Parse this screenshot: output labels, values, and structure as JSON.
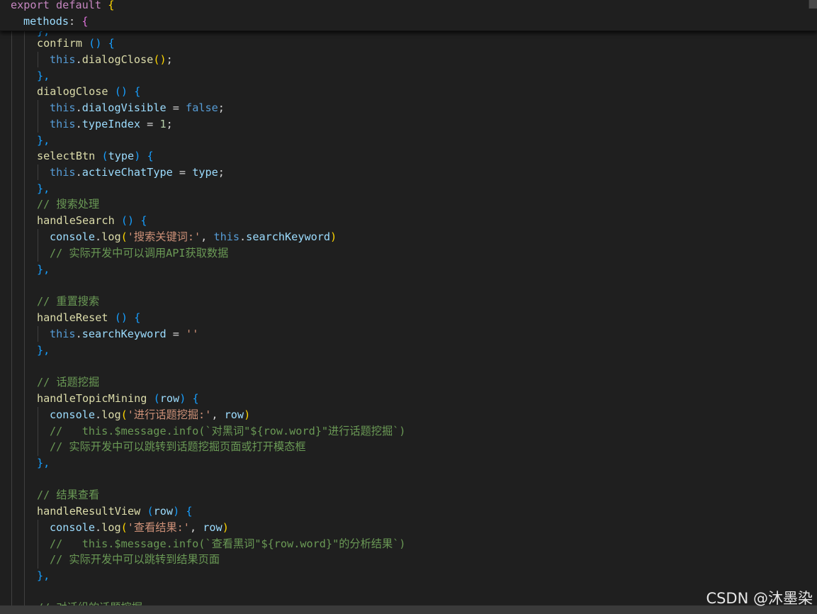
{
  "sticky": {
    "line1": {
      "kw1": "export",
      "kw2": "default",
      "brace": "{"
    },
    "line2": {
      "name": "methods",
      "colon": ":",
      "brace": "{"
    },
    "peek": "},"
  },
  "code": {
    "confirm": {
      "name": "confirm",
      "parens": "()",
      "brace": "{"
    },
    "confirm_body": {
      "this": "this",
      "dot": ".",
      "call": "dialogClose",
      "args": "()",
      "semi": ";"
    },
    "close1": "},",
    "dialogClose": {
      "name": "dialogClose",
      "parens": "()",
      "brace": "{"
    },
    "dc_line1": {
      "this": "this",
      "dot": ".",
      "prop": "dialogVisible",
      "eq": " = ",
      "val": "false",
      "semi": ";"
    },
    "dc_line2": {
      "this": "this",
      "dot": ".",
      "prop": "typeIndex",
      "eq": " = ",
      "val": "1",
      "semi": ";"
    },
    "close2": "},",
    "selectBtn": {
      "name": "selectBtn",
      "open": "(",
      "param": "type",
      "close": ")",
      "brace": "{"
    },
    "sb_line1": {
      "this": "this",
      "dot": ".",
      "prop": "activeChatType",
      "eq": " = ",
      "val": "type",
      "semi": ";"
    },
    "close3": "},",
    "comment_search": "// 搜索处理",
    "handleSearch": {
      "name": "handleSearch",
      "parens": "()",
      "brace": "{"
    },
    "hs_line1": {
      "obj": "console",
      "dot": ".",
      "fn": "log",
      "open": "(",
      "str": "'搜索关键词:'",
      "comma": ", ",
      "this": "this",
      "dot2": ".",
      "prop": "searchKeyword",
      "close": ")"
    },
    "hs_comment": "// 实际开发中可以调用API获取数据",
    "close4": "},",
    "comment_reset": "// 重置搜索",
    "handleReset": {
      "name": "handleReset",
      "parens": "()",
      "brace": "{"
    },
    "hr_line1": {
      "this": "this",
      "dot": ".",
      "prop": "searchKeyword",
      "eq": " = ",
      "val": "''"
    },
    "close5": "},",
    "comment_topic": "// 话题挖掘",
    "handleTopicMining": {
      "name": "handleTopicMining",
      "open": "(",
      "param": "row",
      "close": ")",
      "brace": "{"
    },
    "ht_line1": {
      "obj": "console",
      "dot": ".",
      "fn": "log",
      "open": "(",
      "str": "'进行话题挖掘:'",
      "comma": ", ",
      "arg": "row",
      "close": ")"
    },
    "ht_comment1": "//   this.$message.info(`对黑词\"${row.word}\"进行话题挖掘`)",
    "ht_comment2": "// 实际开发中可以跳转到话题挖掘页面或打开模态框",
    "close6": "},",
    "comment_result": "// 结果查看",
    "handleResultView": {
      "name": "handleResultView",
      "open": "(",
      "param": "row",
      "close": ")",
      "brace": "{"
    },
    "hv_line1": {
      "obj": "console",
      "dot": ".",
      "fn": "log",
      "open": "(",
      "str": "'查看结果:'",
      "comma": ", ",
      "arg": "row",
      "close": ")"
    },
    "hv_comment1": "//   this.$message.info(`查看黑词\"${row.word}\"的分析结果`)",
    "hv_comment2": "// 实际开发中可以跳转到结果页面",
    "close7": "},",
    "comment_group": "// 对话组的话题挖掘"
  },
  "watermark": "CSDN @沐墨染",
  "colors": {
    "background": "#1f1f1f",
    "keyword": "#c586c0",
    "function": "#dcdcaa",
    "variable": "#9cdcfe",
    "this": "#569cd6",
    "string": "#ce9178",
    "comment": "#6a9955",
    "number": "#b5cea8"
  }
}
